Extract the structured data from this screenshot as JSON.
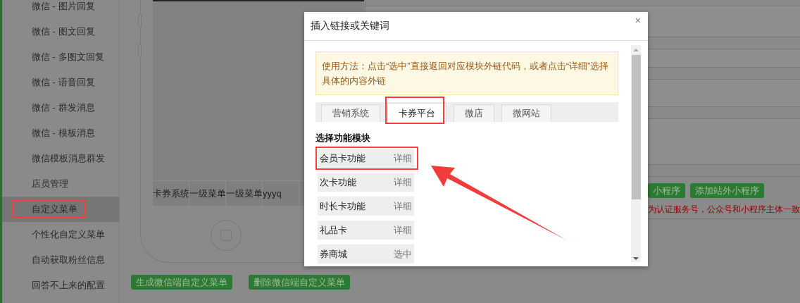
{
  "sidebar": {
    "items": [
      {
        "label": "微信 - 图片回复",
        "selected": false,
        "highlighted": false
      },
      {
        "label": "微信 - 图文回复",
        "selected": false,
        "highlighted": false
      },
      {
        "label": "微信 - 多图文回复",
        "selected": false,
        "highlighted": false
      },
      {
        "label": "微信 - 语音回复",
        "selected": false,
        "highlighted": false
      },
      {
        "label": "微信 - 群发消息",
        "selected": false,
        "highlighted": false
      },
      {
        "label": "微信 - 模板消息",
        "selected": false,
        "highlighted": false
      },
      {
        "label": "微信模板消息群发",
        "selected": false,
        "highlighted": false
      },
      {
        "label": "店员管理",
        "selected": false,
        "highlighted": false
      },
      {
        "label": "自定义菜单",
        "selected": true,
        "highlighted": true
      },
      {
        "label": "个性化自定义菜单",
        "selected": false,
        "highlighted": false
      },
      {
        "label": "自动获取粉丝信息",
        "selected": false,
        "highlighted": false
      },
      {
        "label": "回答不上来的配置",
        "selected": false,
        "highlighted": false
      }
    ]
  },
  "phone": {
    "menu_items": [
      "卡券系统",
      "一级菜单",
      "一级菜单",
      "yyyq"
    ]
  },
  "menu_actions": [
    "生成微信端自定义菜单",
    "删除微信端自定义菜单"
  ],
  "miniprogram_buttons": [
    "小程序",
    "添加站外小程序"
  ],
  "miniprogram_notice": "为认证服务号，公众号和小程序主体一致",
  "dialog": {
    "title": "插入链接或关键词",
    "close": "×",
    "notice": "使用方法：点击“选中”直接返回对应模块外链代码，或者点击“详细”选择具体的内容外链",
    "tabs": [
      {
        "label": "营销系统",
        "selected": false,
        "highlighted": false
      },
      {
        "label": "卡券平台",
        "selected": true,
        "highlighted": true
      },
      {
        "label": "微店",
        "selected": false,
        "highlighted": false
      },
      {
        "label": "微网站",
        "selected": false,
        "highlighted": false
      }
    ],
    "section_title": "选择功能模块",
    "modules": [
      {
        "label": "会员卡功能",
        "action": "详细",
        "highlighted": true
      },
      {
        "label": "次卡功能",
        "action": "详细",
        "highlighted": false
      },
      {
        "label": "时长卡功能",
        "action": "详细",
        "highlighted": false
      },
      {
        "label": "礼品卡",
        "action": "详细",
        "highlighted": false
      },
      {
        "label": "券商城",
        "action": "选中",
        "highlighted": false
      }
    ]
  }
}
